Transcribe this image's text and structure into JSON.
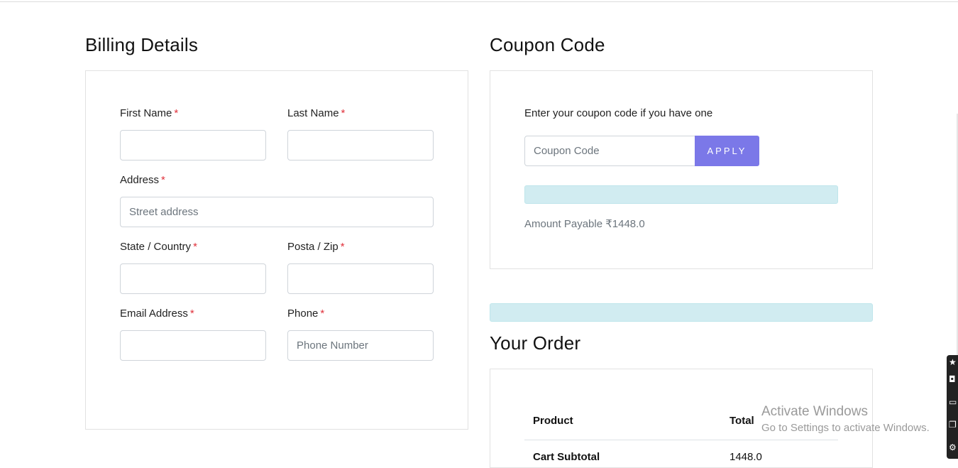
{
  "billing": {
    "title": "Billing Details",
    "required_mark": "*",
    "first_name": {
      "label": "First Name",
      "value": "",
      "placeholder": ""
    },
    "last_name": {
      "label": "Last Name",
      "value": "",
      "placeholder": ""
    },
    "address": {
      "label": "Address",
      "value": "",
      "placeholder": "Street address"
    },
    "state_country": {
      "label": "State / Country",
      "value": "",
      "placeholder": ""
    },
    "postal_zip": {
      "label": "Posta / Zip",
      "value": "",
      "placeholder": ""
    },
    "email": {
      "label": "Email Address",
      "value": "",
      "placeholder": ""
    },
    "phone": {
      "label": "Phone",
      "value": "",
      "placeholder": "Phone Number"
    }
  },
  "coupon": {
    "title": "Coupon Code",
    "hint": "Enter your coupon code if you have one",
    "input_placeholder": "Coupon Code",
    "apply_label": "APPLY",
    "amount_text": "Amount Payable ₹1448.0"
  },
  "order": {
    "title": "Your Order",
    "columns": [
      "Product",
      "Total"
    ],
    "rows": [
      {
        "product": "Cart Subtotal",
        "total": "1448.0"
      }
    ]
  },
  "watermark": {
    "title": "Activate Windows",
    "subtitle": "Go to Settings to activate Windows."
  },
  "colors": {
    "accent": "#7b78e8",
    "required": "#e0313b",
    "info_bar": "#d1ecf1"
  }
}
